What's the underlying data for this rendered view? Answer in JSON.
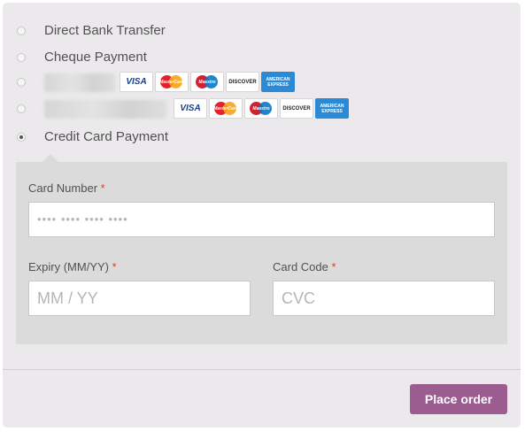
{
  "payment_methods": [
    {
      "label": "Direct Bank Transfer",
      "checked": false
    },
    {
      "label": "Cheque Payment",
      "checked": false
    },
    {
      "label": "",
      "checked": false,
      "obscured": true,
      "cards": [
        "VISA",
        "MasterCard",
        "Maestro",
        "DISCOVER",
        "AMERICAN EXPRESS"
      ]
    },
    {
      "label": "",
      "checked": false,
      "obscured": true,
      "cards": [
        "VISA",
        "MasterCard",
        "Maestro",
        "DISCOVER",
        "AMERICAN EXPRESS"
      ]
    },
    {
      "label": "Credit Card Payment",
      "checked": true
    }
  ],
  "card_labels": {
    "visa": "VISA",
    "mastercard": "MasterCard",
    "maestro": "Maestro",
    "discover": "DISCOVER",
    "amex": "AMERICAN EXPRESS"
  },
  "credit_card_form": {
    "card_number": {
      "label": "Card Number",
      "required_mark": "*",
      "placeholder": "•••• •••• •••• ••••"
    },
    "expiry": {
      "label": "Expiry (MM/YY)",
      "required_mark": "*",
      "placeholder": "MM / YY"
    },
    "card_code": {
      "label": "Card Code",
      "required_mark": "*",
      "placeholder": "CVC"
    }
  },
  "actions": {
    "place_order_label": "Place order"
  },
  "colors": {
    "panel_bg": "#ebe9eb",
    "form_bg": "#dcdbdc",
    "button_bg": "#9b5c8f",
    "required": "#e2401c"
  }
}
